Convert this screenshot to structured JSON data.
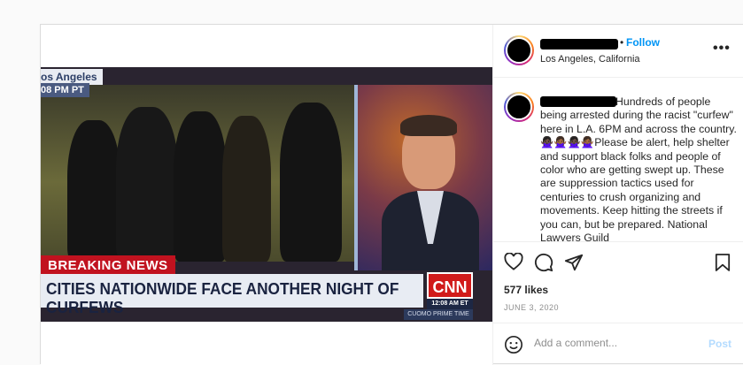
{
  "post": {
    "account": {
      "location": "Los Angeles, California",
      "follow_label": "Follow",
      "separator": "•",
      "more_label": "•••"
    },
    "media": {
      "tv_location": "os Angeles",
      "tv_time": "08 PM PT",
      "breaking_label": "BREAKING NEWS",
      "headline": "CITIES NATIONWIDE FACE ANOTHER NIGHT OF CURFEWS",
      "network": "CNN",
      "clock": "12:08 AM ET",
      "show": "CUOMO PRIME TIME"
    },
    "caption": "Hundreds of people being arrested during the racist \"curfew\" here in L.A. 6PM and across the country. 🙅🏿‍♀️🙅🏾‍♀️🙅🏿‍♀️🙅🏾‍♀️Please be alert, help shelter and support black folks and people of color who are getting swept up. These are suppression tactics used for centuries to crush organizing and movements. Keep hitting the streets if you can, but be prepared. National Lawyers Guild",
    "likes": "577 likes",
    "date": "JUNE 3, 2020",
    "comment_placeholder": "Add a comment...",
    "post_label": "Post"
  },
  "icons": [
    "heart-icon",
    "comment-icon",
    "share-icon",
    "bookmark-icon",
    "emoji-icon",
    "more-icon"
  ],
  "colors": {
    "link": "#0095f6",
    "breaking": "#c1121f",
    "cnn": "#d11a1a",
    "post_disabled": "#b3dbff"
  }
}
